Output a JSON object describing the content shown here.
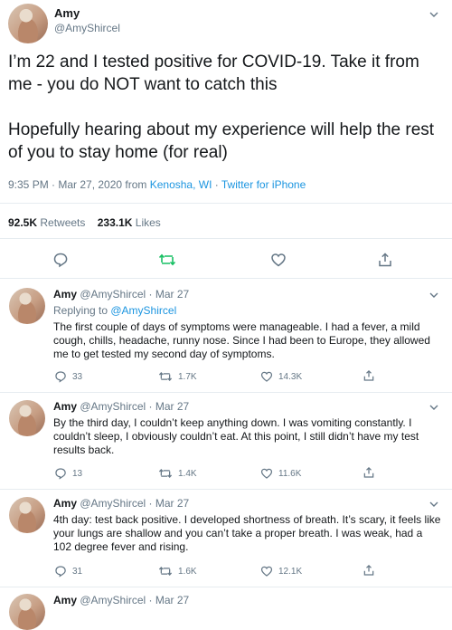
{
  "tweet": {
    "name": "Amy",
    "handle": "@AmyShircel",
    "text": "I’m 22 and I tested positive for COVID-19. Take it from me - you do NOT want to catch this\n\nHopefully hearing about my experience will help the rest of you to stay home (for real)",
    "time": "9:35 PM · Mar 27, 2020 from ",
    "location": "Kenosha, WI",
    "source_sep": " · ",
    "source": "Twitter for iPhone",
    "retweets_count": "92.5K",
    "retweets_label": " Retweets",
    "likes_count": "233.1K",
    "likes_label": " Likes",
    "accent_color": "#1b95e0",
    "retweet_color": "#17bf63",
    "icons": [
      "reply-icon",
      "retweet-icon",
      "like-icon",
      "share-icon",
      "chevron-down-icon"
    ]
  },
  "replies": [
    {
      "name": "Amy",
      "handle_date": " @AmyShircel · Mar 27",
      "replying_prefix": "Replying to ",
      "replying_to": "@AmyShircel",
      "text": "The first couple of days of symptoms were manageable. I had a fever, a mild cough, chills, headache, runny nose. Since I had been to Europe, they allowed me to get tested my second day of symptoms.",
      "replies": "33",
      "retweets": "1.7K",
      "likes": "14.3K"
    },
    {
      "name": "Amy",
      "handle_date": " @AmyShircel · Mar 27",
      "text": "By the third day, I couldn’t keep anything down. I was vomiting constantly. I couldn’t sleep, I obviously couldn’t eat. At this point, I still didn’t have my test results back.",
      "replies": "13",
      "retweets": "1.4K",
      "likes": "11.6K"
    },
    {
      "name": "Amy",
      "handle_date": " @AmyShircel · Mar 27",
      "text": "4th day: test back positive. I developed shortness of breath. It’s scary, it feels like your lungs are shallow and you can’t take a proper breath. I was weak, had a 102 degree fever and rising.",
      "replies": "31",
      "retweets": "1.6K",
      "likes": "12.1K"
    },
    {
      "name": "Amy",
      "handle_date": " @AmyShircel · Mar 27"
    }
  ]
}
